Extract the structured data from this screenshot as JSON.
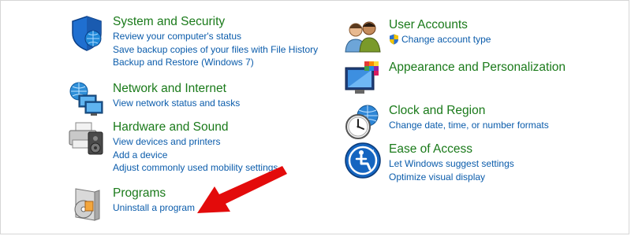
{
  "colors": {
    "title_green": "#1a7a1a",
    "link_blue": "#0b5cab",
    "annotation_arrow": "#e30b0b"
  },
  "left_column": {
    "system_security": {
      "icon": "shield-icon",
      "title": "System and Security",
      "links": [
        "Review your computer's status",
        "Save backup copies of your files with File History",
        "Backup and Restore (Windows 7)"
      ]
    },
    "network_internet": {
      "icon": "network-globe-icon",
      "title": "Network and Internet",
      "links": [
        "View network status and tasks"
      ]
    },
    "hardware_sound": {
      "icon": "printer-speaker-icon",
      "title": "Hardware and Sound",
      "links": [
        "View devices and printers",
        "Add a device",
        "Adjust commonly used mobility settings"
      ]
    },
    "programs": {
      "icon": "programs-disc-icon",
      "title": "Programs",
      "links": [
        "Uninstall a program"
      ]
    }
  },
  "right_column": {
    "user_accounts": {
      "icon": "users-icon",
      "title": "User Accounts",
      "links": [
        "Change account type"
      ],
      "link_icon": "uac-shield-icon"
    },
    "appearance": {
      "icon": "monitor-palette-icon",
      "title": "Appearance and Personalization",
      "links": []
    },
    "clock_region": {
      "icon": "clock-globe-icon",
      "title": "Clock and Region",
      "links": [
        "Change date, time, or number formats"
      ]
    },
    "ease_access": {
      "icon": "ease-of-access-icon",
      "title": "Ease of Access",
      "links": [
        "Let Windows suggest settings",
        "Optimize visual display"
      ]
    }
  },
  "annotation": {
    "icon": "red-arrow-pointer",
    "target": "Uninstall a program"
  }
}
